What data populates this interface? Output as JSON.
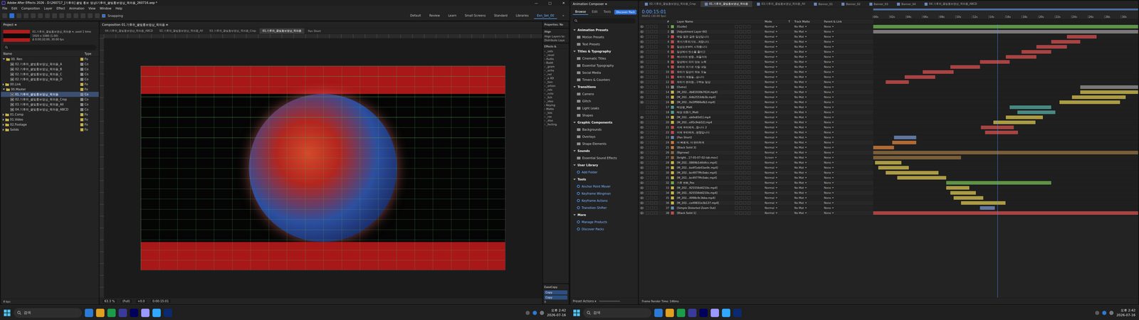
{
  "left_window": {
    "title": "Adobe After Effects 2026 - D:\\260717_[기후위] 클빛 홍보 영상\\기후위_클빛홍보영상_목와용_260716.aep *",
    "controls": [
      "—",
      "□",
      "✕"
    ],
    "menu": [
      "File",
      "Edit",
      "Composition",
      "Layer",
      "Effect",
      "Animation",
      "View",
      "Window",
      "Help"
    ],
    "snapping": {
      "label": "Snapping",
      "checked": true
    },
    "workspaces": [
      {
        "label": "Default",
        "selected": false
      },
      {
        "label": "Review",
        "selected": false
      },
      {
        "label": "Learn",
        "selected": false
      },
      {
        "label": "Small Screens",
        "selected": false
      },
      {
        "label": "Standard",
        "selected": false
      },
      {
        "label": "Libraries",
        "selected": false
      },
      {
        "label": "Exn_Set_00",
        "selected": true
      }
    ],
    "more": "»"
  },
  "project": {
    "tab": "Project ≡",
    "info": [
      "01.기후위_클빛홍보영상_목와용 ▾, used 1 time",
      "1920 x 1080 (1.00)",
      "Δ 0;00;32;00, 30.00 fps"
    ],
    "columns": [
      "Name",
      "Type"
    ],
    "items": [
      {
        "name": "00. Ren",
        "type": "Fo",
        "kind": "folder",
        "depth": 0,
        "expanded": true,
        "selected": false
      },
      {
        "name": "02.기후위_클빛홍보영상_목와용_A",
        "type": "Co",
        "kind": "comp",
        "depth": 1,
        "expanded": false,
        "selected": false
      },
      {
        "name": "02.기후위_클빛홍보영상_목와용_B",
        "type": "Co",
        "kind": "comp",
        "depth": 1,
        "expanded": false,
        "selected": false
      },
      {
        "name": "02.기후위_클빛홍보영상_목와용_C",
        "type": "Co",
        "kind": "comp",
        "depth": 1,
        "expanded": false,
        "selected": false
      },
      {
        "name": "02.기후위_클빛홍보영상_목와용_D",
        "type": "Co",
        "kind": "comp",
        "depth": 1,
        "expanded": false,
        "selected": false
      },
      {
        "name": "00.Link",
        "type": "Fo",
        "kind": "folder",
        "depth": 0,
        "expanded": false,
        "selected": false
      },
      {
        "name": "00.Master",
        "type": "Fo",
        "kind": "folder",
        "depth": 0,
        "expanded": true,
        "selected": false
      },
      {
        "name": "01.기후위_클빛홍보영상_목와용",
        "type": "Co",
        "kind": "comp",
        "depth": 1,
        "expanded": false,
        "selected": true
      },
      {
        "name": "02.기후위_클빛홍보영상_목와용_Crop",
        "type": "Co",
        "kind": "comp",
        "depth": 1,
        "expanded": false,
        "selected": false
      },
      {
        "name": "03.기후위_클빛홍보영상_목와용_All",
        "type": "Co",
        "kind": "comp",
        "depth": 1,
        "expanded": false,
        "selected": false
      },
      {
        "name": "04.기후위_클빛홍보영상_목와용_ABCD",
        "type": "Co",
        "kind": "comp",
        "depth": 1,
        "expanded": false,
        "selected": false
      },
      {
        "name": "01.Comp",
        "type": "Fo",
        "kind": "folder",
        "depth": 0,
        "expanded": false,
        "selected": false
      },
      {
        "name": "01.Video",
        "type": "Fo",
        "kind": "folder",
        "depth": 0,
        "expanded": false,
        "selected": false
      },
      {
        "name": "02.Footage",
        "type": "Fo",
        "kind": "folder",
        "depth": 0,
        "expanded": false,
        "selected": false
      },
      {
        "name": "Solids",
        "type": "Fo",
        "kind": "folder",
        "depth": 0,
        "expanded": false,
        "selected": false
      }
    ],
    "bpc": "8 bpc"
  },
  "viewer": {
    "title": "Composition 01.기후위_클빛홍보영상_목와용 ≡",
    "tabs": [
      {
        "label": "04.기후위_클빛홍보영상_목와용_ABCD",
        "selected": false
      },
      {
        "label": "02.기후위_클빛홍보영상_목와용_All",
        "selected": false
      },
      {
        "label": "03.기후위_클빛홍보영상_목와용_Crop",
        "selected": false
      },
      {
        "label": "01.기후위_클빛홍보영상_목와용",
        "selected": true
      },
      {
        "label": "Pan Short",
        "selected": false
      }
    ],
    "zoom": "63.3 %",
    "resolution": "(Full)",
    "exposure": "+0.0",
    "time": "0:00:15:01"
  },
  "side_panels": {
    "properties": "Properties: No",
    "align": "Align",
    "align_lines": [
      "Align Layers to:",
      "Distribute Laye"
    ],
    "effects": "Effects &",
    "effect_items": [
      "› _sets",
      "› _revel",
      "› Audio",
      "› Badd",
      "› _gram",
      "› _ocha",
      "› _nel",
      "› _e 4D",
      "› _tion",
      "› _ortion",
      "› _rols",
      "› _ncte",
      "› _llch",
      "› _ideo",
      "› Keying",
      "› Matte",
      "› _lele",
      "› _rse",
      "› _dise",
      "› _fecting"
    ],
    "easecopy": "EaseCopy",
    "ease_buttons": [
      "Copy",
      "Copy"
    ],
    "ease_value": "0"
  },
  "animation_composer": {
    "title": "Animation Composer ≡",
    "tabs": [
      {
        "label": "Browse",
        "selected": true
      },
      {
        "label": "Edit",
        "selected": false
      },
      {
        "label": "Tools",
        "selected": false
      }
    ],
    "discover": "Discover Pack",
    "entries": [
      {
        "label": "Animation Presets",
        "kind": "section"
      },
      {
        "label": "Motion Presets",
        "kind": "item"
      },
      {
        "label": "Text Presets",
        "kind": "item"
      },
      {
        "label": "Titles & Typography",
        "kind": "section"
      },
      {
        "label": "Cinematic Titles",
        "kind": "item"
      },
      {
        "label": "Essential Typography",
        "kind": "item"
      },
      {
        "label": "Social Media",
        "kind": "item"
      },
      {
        "label": "Timers & Counters",
        "kind": "item"
      },
      {
        "label": "Transitions",
        "kind": "section"
      },
      {
        "label": "Camera",
        "kind": "item"
      },
      {
        "label": "Glitch",
        "kind": "item"
      },
      {
        "label": "Light Leaks",
        "kind": "item"
      },
      {
        "label": "Shapes",
        "kind": "item"
      },
      {
        "label": "Graphic Components",
        "kind": "section"
      },
      {
        "label": "Backgrounds",
        "kind": "item"
      },
      {
        "label": "Overlays",
        "kind": "item"
      },
      {
        "label": "Shape Elements",
        "kind": "item"
      },
      {
        "label": "Sounds",
        "kind": "section"
      },
      {
        "label": "Essential Sound Effects",
        "kind": "item"
      },
      {
        "label": "User Library",
        "kind": "section"
      },
      {
        "label": "Add Folder",
        "kind": "action"
      },
      {
        "label": "Tools",
        "kind": "section"
      },
      {
        "label": "Anchor Point Mover",
        "kind": "action"
      },
      {
        "label": "Keyframe Wingman",
        "kind": "action"
      },
      {
        "label": "Keyframe Actions",
        "kind": "action"
      },
      {
        "label": "Transition Shifter",
        "kind": "action"
      },
      {
        "label": "More",
        "kind": "section"
      },
      {
        "label": "Manage Products",
        "kind": "action"
      },
      {
        "label": "Discover Packs",
        "kind": "action"
      }
    ],
    "footer": "Preset Actions ▾"
  },
  "timeline": {
    "tabs": [
      {
        "label": "02.기후위_클빛홍보영상_목와용_Crop",
        "selected": false
      },
      {
        "label": "01.기후위_클빛홍보영상_목와용",
        "selected": true
      },
      {
        "label": "03.기후위_클빛홍보영상_목와용_All",
        "selected": false
      },
      {
        "label": "Banner_01",
        "selected": false
      },
      {
        "label": "Banner_02",
        "selected": false
      },
      {
        "label": "Banner_03",
        "selected": false
      },
      {
        "label": "Banner_04",
        "selected": false
      },
      {
        "label": "04.기후위_클빛홍보영상_목와용_ABCD",
        "selected": false
      }
    ],
    "time": "0:00:15:01",
    "frames": "00451 (30.00 fps)",
    "columns": [
      "#",
      "Layer Name",
      "Mode",
      "T",
      "Track Matte",
      "Parent & Link"
    ],
    "duration": 32,
    "current": 15.03,
    "ticks": [
      {
        "label": "00s",
        "t": 0
      },
      {
        "label": "02s",
        "t": 2
      },
      {
        "label": "04s",
        "t": 4
      },
      {
        "label": "06s",
        "t": 6
      },
      {
        "label": "08s",
        "t": 8
      },
      {
        "label": "10s",
        "t": 10
      },
      {
        "label": "12s",
        "t": 12
      },
      {
        "label": "14s",
        "t": 14
      },
      {
        "label": "16s",
        "t": 16
      },
      {
        "label": "18s",
        "t": 18
      },
      {
        "label": "20s",
        "t": 20
      },
      {
        "label": "22s",
        "t": 22
      },
      {
        "label": "24s",
        "t": 24
      },
      {
        "label": "26s",
        "t": 26
      },
      {
        "label": "28s",
        "t": 28
      },
      {
        "label": "30s",
        "t": 30
      }
    ],
    "layers": [
      {
        "num": "1",
        "name": "[Guide]",
        "color": "#6aa84f",
        "visible": true,
        "mode": "Normal",
        "matte": "No Mat",
        "parent": "None",
        "span": [
          0,
          32
        ]
      },
      {
        "num": "2",
        "name": "[Adjustment Layer 60]",
        "color": "#8a8a8a",
        "visible": true,
        "mode": "Normal",
        "matte": "No Mat",
        "parent": "None",
        "span": [
          0,
          32
        ]
      },
      {
        "num": "3",
        "name": "매일 질문 같은 일상입니다",
        "color": "#c24a4a",
        "visible": true,
        "mode": "Normal",
        "matte": "No Mat",
        "parent": "None",
        "span": [
          23.4,
          27
        ]
      },
      {
        "num": "4",
        "name": "국가기후위기대...계합니다",
        "color": "#c24a4a",
        "visible": true,
        "mode": "Normal",
        "matte": "No Mat",
        "parent": "None",
        "span": [
          21.5,
          25
        ]
      },
      {
        "num": "5",
        "name": "일상으로부터 시작됩니다",
        "color": "#c24a4a",
        "visible": true,
        "mode": "Normal",
        "matte": "No Mat",
        "parent": "None",
        "span": [
          19.7,
          23.4
        ]
      },
      {
        "num": "6",
        "name": "일상에서 탄소를 줄이고",
        "color": "#c24a4a",
        "visible": true,
        "mode": "Normal",
        "matte": "No Mat",
        "parent": "None",
        "span": [
          17.9,
          21.5
        ]
      },
      {
        "num": "7",
        "name": "에너지의 방향...되돌아와",
        "color": "#c24a4a",
        "visible": true,
        "mode": "Normal",
        "matte": "No Mat",
        "parent": "None",
        "span": [
          16,
          19.7
        ]
      },
      {
        "num": "8",
        "name": "일상에서 의지 있는 노력",
        "color": "#c24a4a",
        "visible": true,
        "mode": "Normal",
        "matte": "No Mat",
        "parent": "None",
        "span": [
          12.9,
          16.5
        ]
      },
      {
        "num": "9",
        "name": "우리의 위기로 지킬 내일",
        "color": "#c24a4a",
        "visible": true,
        "mode": "Normal",
        "matte": "No Mat",
        "parent": "None",
        "span": [
          9.3,
          12.9
        ]
      },
      {
        "num": "10",
        "name": "우리가 일상이 되는 오늘",
        "color": "#c24a4a",
        "visible": true,
        "mode": "Normal",
        "matte": "No Mat",
        "parent": "None",
        "span": [
          6,
          9.7
        ]
      },
      {
        "num": "11",
        "name": "우리가 계절을...습니다",
        "color": "#c24a4a",
        "visible": true,
        "mode": "Normal",
        "matte": "No Mat",
        "parent": "None",
        "span": [
          3.8,
          7.5
        ]
      },
      {
        "num": "12",
        "name": "우리가 편의점...구하는 일상",
        "color": "#c24a4a",
        "visible": true,
        "mode": "Normal",
        "matte": "No Mat",
        "parent": "None",
        "span": [
          1.5,
          4.3
        ]
      },
      {
        "num": "13",
        "name": "[Outro]",
        "color": "#8a8a8a",
        "visible": true,
        "mode": "Normal",
        "matte": "No Mat",
        "parent": "None",
        "span": [
          25,
          32
        ]
      },
      {
        "num": "14",
        "name": "[M_202...4b81930b7624.mp4]",
        "color": "#c4b24a",
        "visible": true,
        "mode": "Normal",
        "matte": "No Mat",
        "parent": "None",
        "span": [
          25,
          32
        ]
      },
      {
        "num": "15",
        "name": "[M_202...6db2553db3b.mp4]",
        "color": "#c4b24a",
        "visible": true,
        "mode": "Normal",
        "matte": "No Mat",
        "parent": "None",
        "span": [
          24,
          30.5
        ]
      },
      {
        "num": "16",
        "name": "[M_202...0e5ff966efb3.mp4]",
        "color": "#c4b24a",
        "visible": true,
        "mode": "Normal",
        "matte": "No Mat",
        "parent": "None",
        "span": [
          22.5,
          29.8
        ]
      },
      {
        "num": "17",
        "name": "태양광_Matt",
        "color": "#4f9d93",
        "visible": false,
        "mode": "Normal",
        "matte": "No Mat",
        "parent": "None",
        "span": [
          16.5,
          21.5
        ]
      },
      {
        "num": "18",
        "name": "태양 전환기_Matt",
        "color": "#4f9d93",
        "visible": false,
        "mode": "Normal",
        "matte": "No Mat",
        "parent": "None",
        "span": [
          17.4,
          22
        ]
      },
      {
        "num": "19",
        "name": "[M_202...eb0e83d1].mp4",
        "color": "#c4b24a",
        "visible": true,
        "mode": "Normal",
        "matte": "No Mat",
        "parent": "None",
        "span": [
          16,
          20.5
        ]
      },
      {
        "num": "20",
        "name": "[M_202...e95c9eb52].mp4",
        "color": "#c4b24a",
        "visible": true,
        "mode": "Normal",
        "matte": "No Mat",
        "parent": "None",
        "span": [
          14.5,
          19.6
        ]
      },
      {
        "num": "21",
        "name": "이제 우리에게...합니다 2",
        "color": "#c24a4a",
        "visible": true,
        "mode": "Normal",
        "matte": "No Mat",
        "parent": "None",
        "span": [
          13,
          17
        ]
      },
      {
        "num": "22",
        "name": "이제 우리에게...방향입니다",
        "color": "#c24a4a",
        "visible": true,
        "mode": "Normal",
        "matte": "No Mat",
        "parent": "None",
        "span": [
          13.5,
          17.5
        ]
      },
      {
        "num": "23",
        "name": "[Pan Short]",
        "color": "#6d86b8",
        "visible": true,
        "mode": "Normal",
        "matte": "No Mat",
        "parent": "None",
        "span": [
          2.5,
          5.2
        ]
      },
      {
        "num": "24",
        "name": "더 빠르게, 더 편리하게",
        "color": "#c9783a",
        "visible": true,
        "mode": "Normal",
        "matte": "No Mat",
        "parent": "None",
        "span": [
          2.3,
          5.2
        ]
      },
      {
        "num": "25",
        "name": "[Black Solid 3]",
        "color": "#c9783a",
        "visible": true,
        "mode": "Normal",
        "matte": "No Mat",
        "parent": "None",
        "span": [
          0,
          2.5
        ]
      },
      {
        "num": "26",
        "name": "[Bgrnew]",
        "color": "#8b6a3e",
        "visible": true,
        "mode": "Normal",
        "matte": "No Mat",
        "parent": "None",
        "span": [
          0,
          32
        ]
      },
      {
        "num": "27",
        "name": "[bright...17-05-07-02-lab.mov]",
        "color": "#8b6a3e",
        "visible": true,
        "mode": "Screen",
        "matte": "No Mat",
        "parent": "None",
        "span": [
          0,
          10.6
        ]
      },
      {
        "num": "28",
        "name": "[M_202...0869b1d4d4cc.mp4]",
        "color": "#c4b24a",
        "visible": true,
        "mode": "Normal",
        "matte": "No Mat",
        "parent": "None",
        "span": [
          0.2,
          3.4
        ]
      },
      {
        "num": "29",
        "name": "[M_202...ba4f1eb43ae9c.mp4]",
        "color": "#c4b24a",
        "visible": true,
        "mode": "Normal",
        "matte": "No Mat",
        "parent": "None",
        "span": [
          0.6,
          4.3
        ]
      },
      {
        "num": "30",
        "name": "[M_202...bc4977ffc0abc.mp4]",
        "color": "#c4b24a",
        "visible": true,
        "mode": "Normal",
        "matte": "No Mat",
        "parent": "None",
        "span": [
          1.5,
          7.9
        ]
      },
      {
        "num": "31",
        "name": "[M_202...bc4977ffc0abc.mp4]",
        "color": "#c4b24a",
        "visible": true,
        "mode": "Normal",
        "matte": "No Mat",
        "parent": "None",
        "span": [
          2.9,
          8.8
        ]
      },
      {
        "num": "32",
        "name": "기후 변화_Pos",
        "color": "#6aa84f",
        "visible": true,
        "mode": "Normal",
        "matte": "No Mat",
        "parent": "None",
        "span": [
          8.8,
          21.5
        ]
      },
      {
        "num": "33",
        "name": "[M_202...925556d4210e.mp4]",
        "color": "#c4b24a",
        "visible": true,
        "mode": "Normal",
        "matte": "No Mat",
        "parent": "None",
        "span": [
          8.8,
          11.6
        ]
      },
      {
        "num": "34",
        "name": "[M_202...925556d4210e.mp4]",
        "color": "#c4b24a",
        "visible": true,
        "mode": "Normal",
        "matte": "No Mat",
        "parent": "None",
        "span": [
          9.3,
          12.4
        ]
      },
      {
        "num": "35",
        "name": "[M_202...4998c9c3bba.mp4]",
        "color": "#c4b24a",
        "visible": true,
        "mode": "Normal",
        "matte": "No Mat",
        "parent": "None",
        "span": [
          9.7,
          13.3
        ]
      },
      {
        "num": "36",
        "name": "[M_202...ce49831e3b137.mp4]",
        "color": "#c4b24a",
        "visible": true,
        "mode": "Normal",
        "matte": "No Mat",
        "parent": "None",
        "span": [
          10.6,
          16
        ]
      },
      {
        "num": "37",
        "name": "[Simple Distorted Zoom Out]",
        "color": "#6d86b8",
        "visible": true,
        "mode": "Normal",
        "matte": "No Mat",
        "parent": "None",
        "span": [
          12.9,
          14.7
        ]
      },
      {
        "num": "38",
        "name": "[Black Solid 1]",
        "color": "#c24a4a",
        "visible": true,
        "mode": "Normal",
        "matte": "No Mat",
        "parent": "None",
        "span": [
          0,
          32
        ]
      }
    ],
    "footer": "Frame Render Time: 146ms"
  },
  "taskbars": [
    {
      "search": "검색",
      "time": "오후 2:42",
      "date": "2026-07-16"
    },
    {
      "search": "검색",
      "time": "오후 2:42",
      "date": "2026-07-16"
    }
  ]
}
